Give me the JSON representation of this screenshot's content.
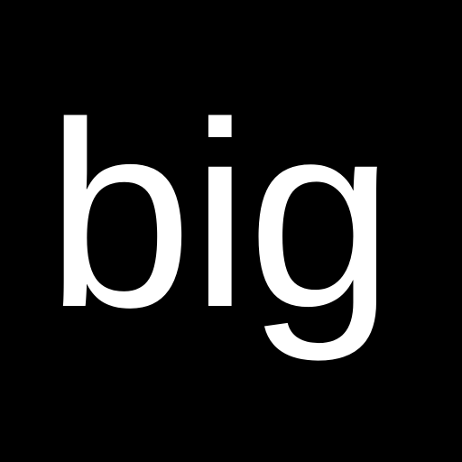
{
  "logo": {
    "text": "big",
    "text_color": "#ffffff",
    "background_color": "#000000"
  }
}
